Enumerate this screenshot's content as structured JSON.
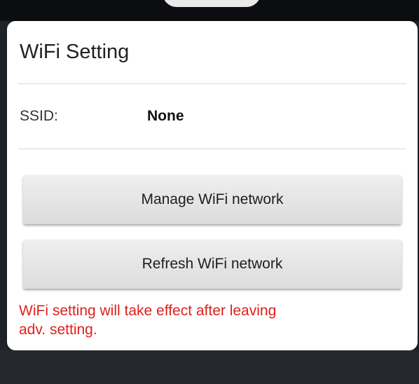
{
  "dialog": {
    "title": "WiFi Setting",
    "ssid_label": "SSID:",
    "ssid_value": "None",
    "manage_button_label": "Manage WiFi network",
    "refresh_button_label": "Refresh WiFi network",
    "notice_line1": "WiFi setting will take effect after leaving",
    "notice_line2": "adv. setting.",
    "notice_color": "#e0201a"
  }
}
